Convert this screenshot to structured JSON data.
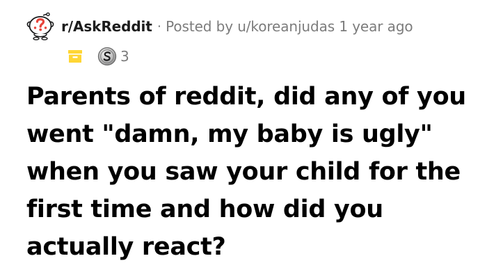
{
  "post": {
    "subreddit": "r/AskReddit",
    "separator": "·",
    "posted_by": "Posted by u/koreanjudas 1 year ago",
    "award_count": "3",
    "title": "Parents of reddit, did any of you went \"damn, my baby is ugly\" when you saw your child for the first time and how did you actually react?"
  },
  "icons": {
    "subreddit_avatar": "askreddit-snoo-icon",
    "archived": "archive-icon",
    "award": "silver-award-icon"
  },
  "colors": {
    "avatar_red": "#e8453c",
    "archive_yellow": "#ffd635",
    "silver": "#c0c0c0",
    "meta_gray": "#7c7c7c",
    "title_black": "#000000"
  }
}
